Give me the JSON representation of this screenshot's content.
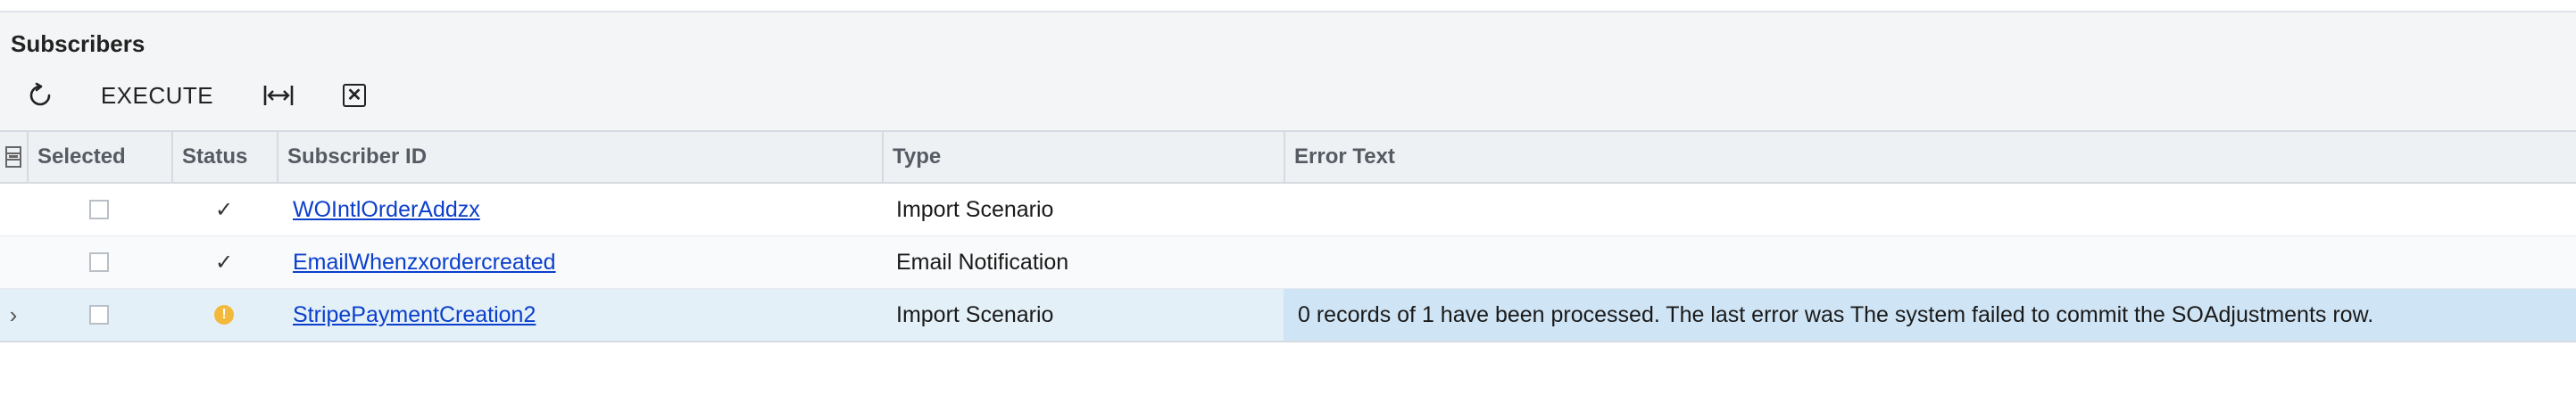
{
  "section": {
    "title": "Subscribers"
  },
  "toolbar": {
    "refresh_icon": "refresh-icon",
    "execute_label": "EXECUTE",
    "fit_icon": "fit-columns-icon",
    "excel_icon": "export-excel-icon"
  },
  "grid": {
    "columns": [
      "Selected",
      "Status",
      "Subscriber ID",
      "Type",
      "Error Text"
    ],
    "rows": [
      {
        "selected": false,
        "status": "ok",
        "subscriber_id": "WOIntlOrderAddzx",
        "type": "Import Scenario",
        "error_text": ""
      },
      {
        "selected": false,
        "status": "ok",
        "subscriber_id": "EmailWhenzxordercreated",
        "type": "Email Notification",
        "error_text": ""
      },
      {
        "selected": false,
        "status": "warning",
        "subscriber_id": "StripePaymentCreation2",
        "type": "Import Scenario",
        "error_text": "0 records of 1 have been processed. The last error was The system failed to commit the SOAdjustments row."
      }
    ]
  },
  "colors": {
    "link": "#0b3fcc",
    "warning": "#f2b93b",
    "selected_row": "#e4f0f8"
  }
}
